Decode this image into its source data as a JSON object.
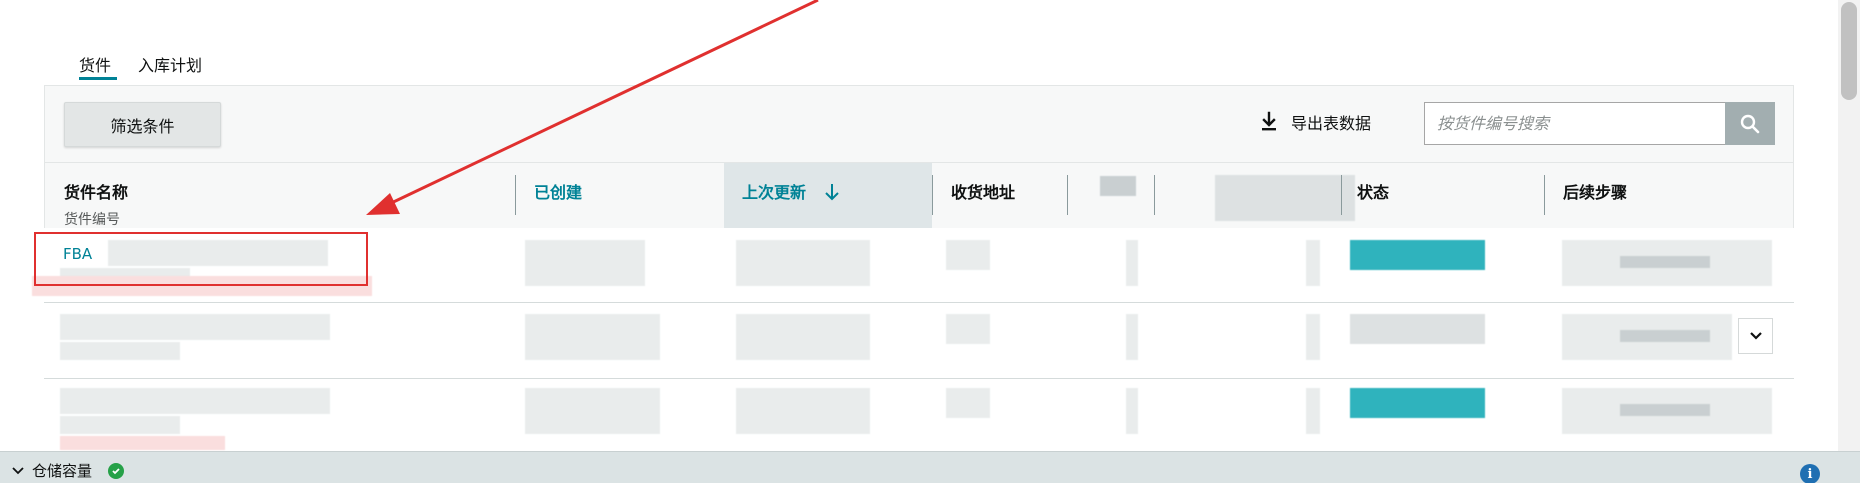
{
  "tabs": [
    {
      "label": "货件",
      "active": true
    },
    {
      "label": "入库计划",
      "active": false
    }
  ],
  "toolbar": {
    "filter_label": "筛选条件",
    "export_label": "导出表数据",
    "search_placeholder": "按货件编号搜索"
  },
  "table": {
    "headers": {
      "name": "货件名称",
      "name_sub": "货件编号",
      "created": "已创建",
      "updated": "上次更新",
      "address": "收货地址",
      "status": "状态",
      "next_steps": "后续步骤"
    },
    "sorted_column": "上次更新",
    "sort_direction": "descending",
    "first_row_name": "FBA"
  },
  "bottom_bar": {
    "label": "仓储容量",
    "status": "ok"
  },
  "colors": {
    "accent": "#008296",
    "annotation_red": "#e0302f",
    "status_teal": "#2fb3bd"
  }
}
